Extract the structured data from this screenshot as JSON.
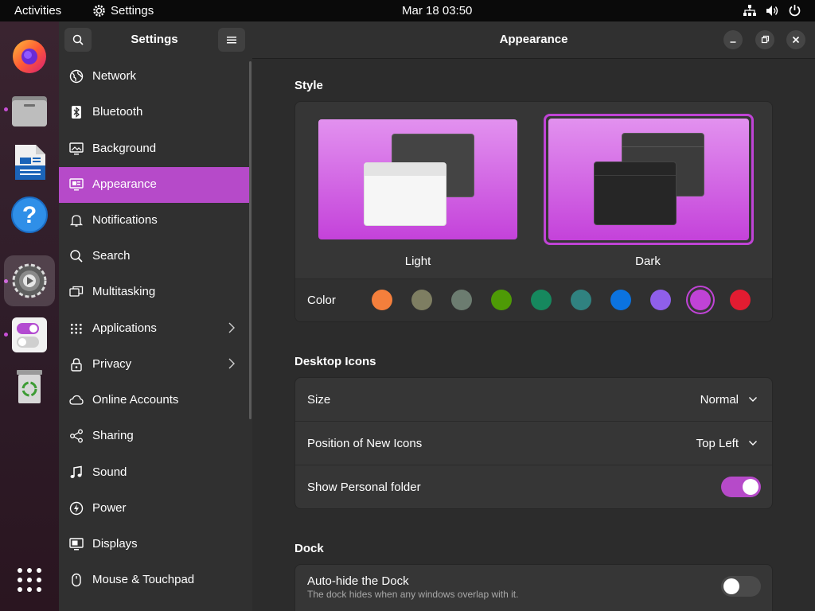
{
  "topbar": {
    "activities": "Activities",
    "app_name": "Settings",
    "clock": "Mar 18  03:50"
  },
  "dock": {
    "items": [
      "firefox-icon",
      "files-icon",
      "writer-icon",
      "help-icon",
      "settings-icon",
      "tweaks-icon",
      "trash-icon"
    ]
  },
  "sidebar": {
    "title": "Settings",
    "items": [
      {
        "label": "Network"
      },
      {
        "label": "Bluetooth"
      },
      {
        "label": "Background"
      },
      {
        "label": "Appearance"
      },
      {
        "label": "Notifications"
      },
      {
        "label": "Search"
      },
      {
        "label": "Multitasking"
      },
      {
        "label": "Applications"
      },
      {
        "label": "Privacy"
      },
      {
        "label": "Online Accounts"
      },
      {
        "label": "Sharing"
      },
      {
        "label": "Sound"
      },
      {
        "label": "Power"
      },
      {
        "label": "Displays"
      },
      {
        "label": "Mouse & Touchpad"
      }
    ]
  },
  "main": {
    "title": "Appearance",
    "style": {
      "title": "Style",
      "light_label": "Light",
      "dark_label": "Dark",
      "selected": "Dark",
      "color_label": "Color",
      "colors": [
        "#f47f3c",
        "#7e7e62",
        "#6c7c70",
        "#4e9a06",
        "#16885e",
        "#308280",
        "#0b73e0",
        "#8f5fea",
        "#c043d6",
        "#e21c31"
      ],
      "selected_color": "#c043d6"
    },
    "desktop_icons": {
      "title": "Desktop Icons",
      "size_label": "Size",
      "size_value": "Normal",
      "position_label": "Position of New Icons",
      "position_value": "Top Left",
      "personal_label": "Show Personal folder",
      "personal_on": true
    },
    "dock": {
      "title": "Dock",
      "autohide_label": "Auto-hide the Dock",
      "autohide_desc": "The dock hides when any windows overlap with it.",
      "autohide_on": false
    }
  },
  "colors": {
    "accent": "#b64ac9",
    "toggle_on": "#b64ac9",
    "toggle_off": "#4a4a4a"
  }
}
